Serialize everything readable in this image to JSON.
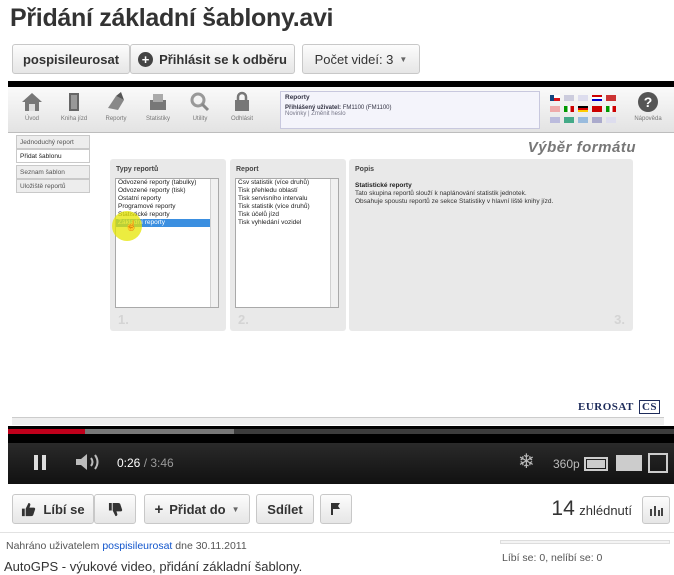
{
  "video": {
    "title": "Přidání základní šablony.avi",
    "channel": "pospisileurosat",
    "subscribe_label": "Přihlásit se k odběru",
    "video_count_label": "Počet videí: 3",
    "time_current": "0:26",
    "time_separator": " / ",
    "time_total": "3:46",
    "quality": "360p",
    "played_fraction": 0.115,
    "loaded_fraction": 0.34
  },
  "app": {
    "toolbar": [
      "Úvod",
      "Kniha jízd",
      "Reporty",
      "Statistiky",
      "Utility",
      "Odhlásit"
    ],
    "reports_box": {
      "title": "Reporty",
      "user_label": "Přihlášený uživatel:",
      "user_value": "FM1100 (FM1100)",
      "links": "Novinky | Změnit heslo"
    },
    "help_label": "Nápověda",
    "side_tabs": [
      "Jednoduchý report",
      "Přidat šablonu",
      "Seznam šablon",
      "Uložiště reportů"
    ],
    "heading": "Výběr formátu",
    "panels": {
      "types": {
        "title": "Typy reportů",
        "items": [
          "Odvozené reporty (tabulky)",
          "Odvozené reporty (tisk)",
          "Ostatní reporty",
          "Programové reporty",
          "Statistické reporty",
          "Základní reporty"
        ],
        "selected_index": 5,
        "number": "1."
      },
      "report": {
        "title": "Report",
        "items": [
          "Csv statistik (více druhů)",
          "Tisk přehledu oblastí",
          "Tisk servisního intervalu",
          "Tisk statistik (více druhů)",
          "Tisk účelů jízd",
          "Tisk vyhledání vozidel"
        ],
        "number": "2."
      },
      "description": {
        "title": "Popis",
        "heading": "Statistické reporty",
        "text": "Tato skupina reportů slouží k naplánování statistik jednotek. Obsahuje spoustu reportů ze sekce Statistiky v hlavní liště knihy jízd.",
        "number": "3."
      }
    },
    "brand": "EUROSAT",
    "brand_suffix": "CS"
  },
  "actions": {
    "like_label": "Líbí se",
    "add_to_label": "Přidat do",
    "share_label": "Sdílet",
    "views_count": "14",
    "views_label": "zhlédnutí"
  },
  "meta": {
    "uploaded_prefix": "Nahráno uživatelem ",
    "uploader": "pospisileurosat",
    "uploaded_suffix": " dne 30.11.2011",
    "description": "AutoGPS - výukové video, přidání základní šablony.",
    "likes_text": "Líbí se: 0, nelíbí se: 0"
  },
  "colors": {
    "progress_played": "#c0001b",
    "selection": "#3b8fe0",
    "link": "#1155cc",
    "cursor_highlight": "#e6e600"
  }
}
